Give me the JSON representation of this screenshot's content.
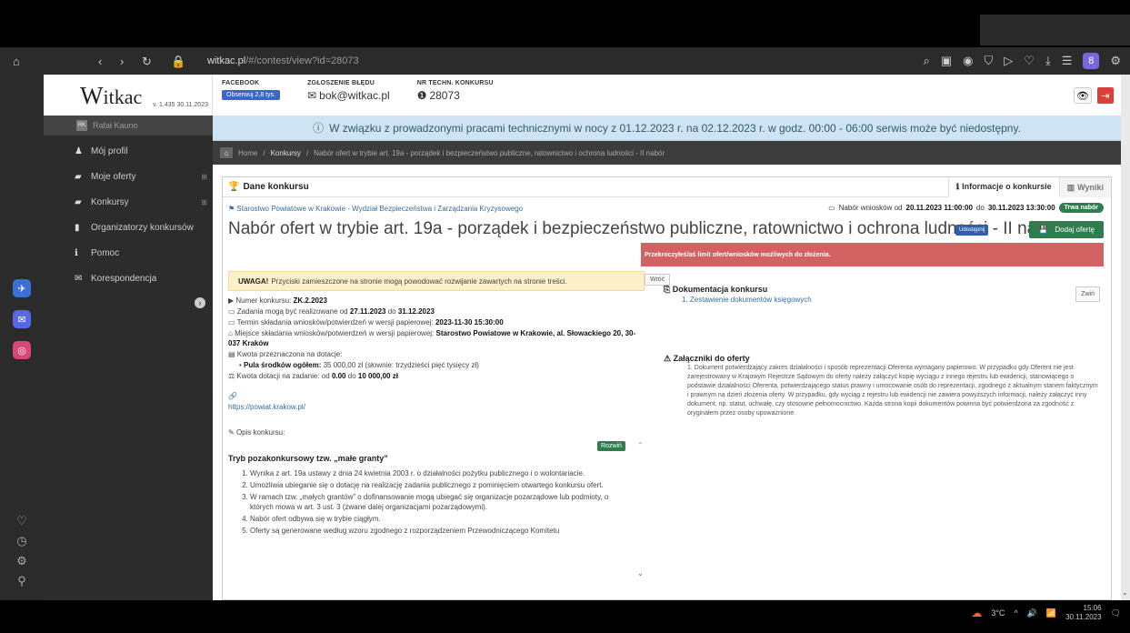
{
  "browser": {
    "url_host": "witkac.pl",
    "url_path": "/#/contest/view?id=28073",
    "profile_letter": "8"
  },
  "app": {
    "logo_text": "itkac",
    "logo_initial": "W",
    "version": "v. 1.435 30.11.2023",
    "header": {
      "facebook_title": "FACEBOOK",
      "facebook_btn": "Obserwuj 2,8 tys.",
      "bug_title": "ZGŁOSZENIE BŁĘDU",
      "bug_email": "bok@witkac.pl",
      "support_title": "NR TECHN. KONKURSU",
      "support_number": "28073"
    },
    "user": {
      "initials": "RK",
      "name": "Rafał Kauno"
    },
    "menu": [
      {
        "label": "Mój profil",
        "icon": "user-icon"
      },
      {
        "label": "Moje oferty",
        "icon": "briefcase-icon"
      },
      {
        "label": "Konkursy",
        "icon": "briefcase-icon"
      },
      {
        "label": "Organizatorzy konkursów",
        "icon": "bookmark-icon"
      },
      {
        "label": "Pomoc",
        "icon": "info-icon"
      },
      {
        "label": "Korespondencja",
        "icon": "envelope-icon"
      }
    ],
    "notice": "W związku z prowadzonymi pracami technicznymi w nocy z 01.12.2023 r. na 02.12.2023 r. w godz. 00:00 - 06:00 serwis może być niedostępny.",
    "breadcrumbs": {
      "home": "Home",
      "konkursy": "Konkursy",
      "current": "Nabór ofert w trybie art. 19a - porządek i bezpieczeństwo publiczne, ratownictwo i ochrona ludności - II nabór"
    }
  },
  "panel": {
    "heading": "Dane konkursu",
    "tab_info": "Informacje o konkursie",
    "tab_results": "Wyniki",
    "organizer": "Starostwo Powiatowe w Krakowie - Wydział Bezpieczeństwa i Zarządzania Kryzysowego",
    "dates_prefix": "Nabór wniosków od",
    "dates_from": "20.11.2023 11:00:00",
    "dates_mid": "do",
    "dates_to": "30.11.2023 13:30:00",
    "status_badge": "Trwa nabór",
    "title": "Nabór ofert w trybie art. 19a - porządek i bezpieczeństwo publiczne, ratownictwo i ochrona ludności - II nabór",
    "btn_small": "Udostępnij",
    "btn_add": "Dodaj ofertę",
    "red_bar": "Przekroczyłeś/aś limit ofert/wniosków możliwych do złożenia.",
    "warning_bold": "UWAGA!",
    "warning_text": "Przyciski zamieszczone na stronie mogą powodować rozwijanie zawartych na stronie treści.",
    "btn_back": "Wróć",
    "details": {
      "number_label": "Numer konkursu:",
      "number_value": "ZK.2.2023",
      "tasks_label": "Zadania mogą być realizowane od",
      "tasks_from": "27.11.2023",
      "tasks_mid": "do",
      "tasks_to": "31.12.2023",
      "deadline_label": "Termin składania wniosków/potwierdzeń w wersji papierowej:",
      "deadline_value": "2023-11-30 15:30:00",
      "place_label": "Miejsce składania wniosków/potwierdzeń w wersji papierowej:",
      "place_value": "Starostwo Powiatowe w Krakowie, al. Słowackiego 20, 30-037 Kraków",
      "amount_label": "Kwota przeznaczona na dotacje:",
      "pool_bold": "Pula środków ogółem:",
      "pool_value": "35 000,00 zł (słownie: trzydzieści pięć tysięcy zł)",
      "grant_label": "Kwota dotacji na zadanie: od",
      "grant_from": "0.00",
      "grant_mid": "do",
      "grant_to": "10 000,00 zł",
      "website": "https://powiat.krakow.pl/"
    },
    "opis_label": "Opis konkursu:",
    "btn_expand": "Rozwiń",
    "opis_title": "Tryb pozakonkursowy tzw. „małe granty”",
    "opis_items": [
      "Wynika z art. 19a ustawy z dnia 24 kwietnia 2003 r. o działalności pożytku publicznego i o wolontariacie.",
      "Umożliwia ubieganie się o dotację na realizację zadania publicznego z pominięciem otwartego konkursu ofert.",
      "W ramach tzw. „małych grantów” o dofinansowanie mogą ubiegać się organizacje pozarządowe lub podmioty, o których mowa w art. 3 ust. 3 (zwane dalej organizacjami pozarządowymi).",
      "Nabór ofert odbywa się w trybie ciągłym.",
      "Oferty są generowane według wzoru zgodnego z rozporządzeniem Przewodniczącego Komitetu"
    ],
    "docs_title": "Dokumentacja konkursu",
    "docs_link": "1. Zestawienie dokumentów księgowych",
    "btn_collapse": "Zwiń",
    "attach_title": "Załączniki do oferty",
    "attach_text": "1. Dokument potwierdzający zakres działalności i sposób reprezentacji Oferenta wymagany papierowo. W przypadku gdy Oferent nie jest zarejestrowany w Krajowym Rejestrze Sądowym do oferty należy załączyć kopię wyciągu z innego rejestru lub ewidencji, stanowiącego o podstawie działalności Oferenta, potwierdzającego status prawny i umocowanie osób do reprezentacji, zgodnego z aktualnym stanem faktycznym i prawnym na dzień złożenia oferty. W przypadku, gdy wyciąg z rejestru lub ewidencji nie zawiera powyższych informacji, należy załączyć inny dokument, np. statut, uchwałę, czy stosowne pełnomocnictwo. Każda strona kopii dokumentów powinna być potwierdzona za zgodność z oryginałem przez osoby upoważnione."
  },
  "taskbar": {
    "temperature": "3°C",
    "time": "15:06",
    "date": "30.11.2023"
  },
  "colors": {
    "accent_green": "#2e7d4e",
    "alert_red": "#d26262",
    "notice_blue": "#cfe4f2",
    "menu_dark": "#2c2c2c"
  }
}
